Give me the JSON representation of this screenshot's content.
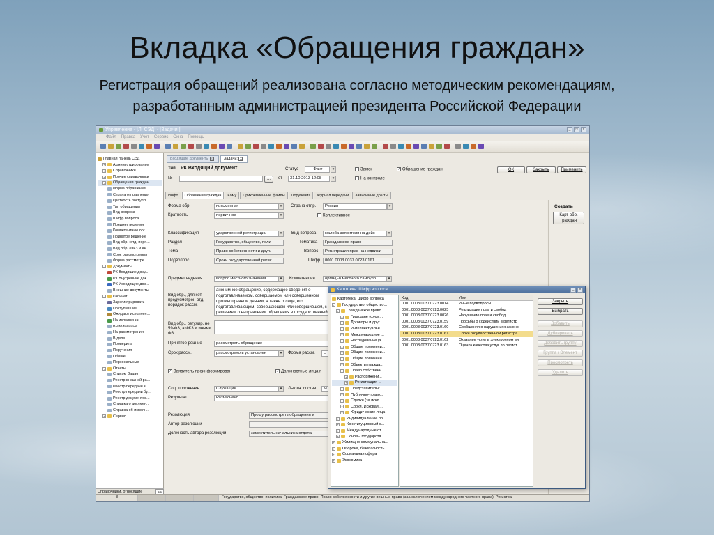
{
  "slide": {
    "title": "Вкладка «Обращения граждан»",
    "subtitle_line1": "Регистрация обращений реализована согласно методическим рекомендациям,",
    "subtitle_line2": "разработанным администрацией президента Российской Федерации"
  },
  "window": {
    "title": "Управление - [Л_СЭД] - [Задачи:]",
    "menu": [
      "Файл",
      "Правка",
      "Учет",
      "Сервис",
      "Окна",
      "Помощь"
    ]
  },
  "left_panel": {
    "items": [
      {
        "label": "Главная панель СЭД",
        "level": 0,
        "icon": "home-icon",
        "exp": ""
      },
      {
        "label": "Администрирование",
        "level": 1,
        "icon": "folder-icon",
        "exp": "+"
      },
      {
        "label": "Справочники",
        "level": 1,
        "icon": "folder-icon",
        "exp": "+"
      },
      {
        "label": "Прочие справочники",
        "level": 1,
        "icon": "folder-icon",
        "exp": "+"
      },
      {
        "label": "Обращения граждан",
        "level": 1,
        "icon": "folder-icon",
        "exp": "-"
      },
      {
        "label": "Форма обращения",
        "level": 2,
        "icon": "doc-icon",
        "exp": ""
      },
      {
        "label": "Страна отправления",
        "level": 2,
        "icon": "doc-icon",
        "exp": ""
      },
      {
        "label": "Кратность поступл...",
        "level": 2,
        "icon": "doc-icon",
        "exp": ""
      },
      {
        "label": "Тип обращения",
        "level": 2,
        "icon": "doc-icon",
        "exp": ""
      },
      {
        "label": "Вид вопроса",
        "level": 2,
        "icon": "doc-icon",
        "exp": ""
      },
      {
        "label": "Шифр вопроса",
        "level": 2,
        "icon": "doc-icon",
        "exp": ""
      },
      {
        "label": "Предмет ведения",
        "level": 2,
        "icon": "doc-icon",
        "exp": ""
      },
      {
        "label": "Компетентные орг...",
        "level": 2,
        "icon": "doc-icon",
        "exp": ""
      },
      {
        "label": "Принятое решение",
        "level": 2,
        "icon": "doc-icon",
        "exp": ""
      },
      {
        "label": "Вид обр. (отд. поря...",
        "level": 2,
        "icon": "doc-icon",
        "exp": ""
      },
      {
        "label": "Вид обр. (ФКЗ и ин...",
        "level": 2,
        "icon": "doc-icon",
        "exp": ""
      },
      {
        "label": "Срок рассмотрения",
        "level": 2,
        "icon": "doc-icon",
        "exp": ""
      },
      {
        "label": "Форма рассмотре...",
        "level": 2,
        "icon": "doc-icon",
        "exp": ""
      },
      {
        "label": "Документы",
        "level": 1,
        "icon": "folder-icon",
        "exp": "-"
      },
      {
        "label": "РК Входящие доку...",
        "level": 2,
        "icon": "doc-red-icon",
        "exp": ""
      },
      {
        "label": "РК Внутренние док...",
        "level": 2,
        "icon": "doc-green-icon",
        "exp": ""
      },
      {
        "label": "РК Исходящие док...",
        "level": 2,
        "icon": "doc-blue-icon",
        "exp": ""
      },
      {
        "label": "Внешние документы",
        "level": 2,
        "icon": "doc-icon",
        "exp": ""
      },
      {
        "label": "Кабинет",
        "level": 1,
        "icon": "folder-icon",
        "exp": "-"
      },
      {
        "label": "Зарегистрировать",
        "level": 2,
        "icon": "pen-icon",
        "exp": ""
      },
      {
        "label": "Поступившие",
        "level": 2,
        "icon": "inbox-icon",
        "exp": ""
      },
      {
        "label": "Ожидают исполнен...",
        "level": 2,
        "icon": "clock-icon",
        "exp": ""
      },
      {
        "label": "На исполнении",
        "level": 2,
        "icon": "check-icon",
        "exp": ""
      },
      {
        "label": "Выполненные",
        "level": 2,
        "icon": "doc-icon",
        "exp": ""
      },
      {
        "label": "На рассмотрении",
        "level": 2,
        "icon": "doc-icon",
        "exp": ""
      },
      {
        "label": "В деле",
        "level": 2,
        "icon": "doc-icon",
        "exp": ""
      },
      {
        "label": "Проверить",
        "level": 2,
        "icon": "doc-icon",
        "exp": ""
      },
      {
        "label": "Поручения",
        "level": 2,
        "icon": "doc-icon",
        "exp": ""
      },
      {
        "label": "Общие",
        "level": 2,
        "icon": "doc-icon",
        "exp": ""
      },
      {
        "label": "Персональные",
        "level": 2,
        "icon": "doc-icon",
        "exp": ""
      },
      {
        "label": "Отчеты",
        "level": 1,
        "icon": "folder-icon",
        "exp": "-"
      },
      {
        "label": "Список. Задач",
        "level": 2,
        "icon": "doc-icon",
        "exp": ""
      },
      {
        "label": "Реестр внешней ра...",
        "level": 2,
        "icon": "doc-icon",
        "exp": ""
      },
      {
        "label": "Реестр передачи з...",
        "level": 2,
        "icon": "doc-icon",
        "exp": ""
      },
      {
        "label": "Реестр передачи бу...",
        "level": 2,
        "icon": "doc-icon",
        "exp": ""
      },
      {
        "label": "Реестр документов...",
        "level": 2,
        "icon": "doc-icon",
        "exp": ""
      },
      {
        "label": "Справка о докумен...",
        "level": 2,
        "icon": "doc-icon",
        "exp": ""
      },
      {
        "label": "Справка об исполн...",
        "level": 2,
        "icon": "doc-icon",
        "exp": ""
      },
      {
        "label": "Сервис",
        "level": 1,
        "icon": "folder-icon",
        "exp": "+"
      }
    ],
    "bottom_label": "Справочники, относящие",
    "bottom_btn": ">>"
  },
  "doc_tabs": [
    "Входящие документы",
    "Задачи:"
  ],
  "header": {
    "type_label": "Тип",
    "type_value": "РК Входящий документ",
    "num_label": "№",
    "num_btn": "...",
    "from_label": "от",
    "date_value": "31.10.2013 12:08",
    "status_label": "Статус",
    "status_value": "Факт",
    "zamok": "Замок",
    "on_control": "На контроле",
    "obr_gr": "Обращение граждан",
    "ok": "ОК",
    "close": "Закрыть",
    "apply": "Применить"
  },
  "page_tabs": [
    "Инфо",
    "Обращения граждан",
    "Кому",
    "Прикрепленные файлы",
    "Поручения",
    "Журнал передачи",
    "Зависимые док-ты"
  ],
  "form": {
    "forma_label": "Форма обр.",
    "forma_value": "письменная",
    "kratn_label": "Кратность",
    "kratn_value": "первичное",
    "country_label": "Страна отпр.",
    "country_value": "Россия",
    "collective": "Коллективное",
    "klass_label": "Классификация",
    "klass_value": "ударственной регистрации",
    "razdel_label": "Раздел",
    "razdel_value": "Государство, общество, поли",
    "tema_label": "Тема",
    "tema_value": "Право собственности и други",
    "podv_label": "Подвопрос",
    "podv_value": "Сроки государственной регис",
    "vidv_label": "Вид вопроса",
    "vidv_value": "жалоба заявителя на дейс",
    "tematika_label": "Тематика",
    "tematika_value": "Гражданское право",
    "vopros_label": "Вопрос",
    "vopros_value": "Регистрация прав на недвижи",
    "shifr_label": "Шифр",
    "shifr_value": "0001.0003.0037.0723.0161",
    "predmet_label": "Предмет ведения",
    "predmet_value": "вопрос местного значения",
    "komp_label": "Компетенция",
    "komp_value": "орган(ы) местного самоупр",
    "vidobr_label": "Вид обр., для кот. предусмотрен отд. порядок рассм.",
    "vidobr_text": "анонимное обращение, содержащее сведения о подготавливаемом, совершаемом или совершенном противоправном деянии, а также о лице, его подготавливающем, совершающем или совершившем, с решением о направлении обращения в государственный орган в соответствии с его компетенцией",
    "vidobr2_label": "Вид обр., регулир. не 59-ФЗ, а ФКЗ и иными ФЗ",
    "resh_label": "Принятое реш-ие",
    "resh_value": "рассмотреть обращение",
    "srok_label": "Срок рассм.",
    "srok_value": "рассмотрено в установлен",
    "formar_label": "Форма рассм.",
    "formar_value": "с",
    "zayav": "Заявитель проинформирован",
    "dolzh": "Должностные лица п",
    "soc_label": "Соц. положение",
    "soc_value": "Служащий",
    "lgot_label": "Льготн. состав",
    "lgot_value": "М",
    "result_label": "Результат",
    "result_value": "Разъяснено",
    "rez_label": "Резолюция",
    "rez_value": "Прошу рассмотреть обращения и",
    "avtor_label": "Автор резолюции",
    "dolzhav_label": "Должность автора резолюции",
    "dolzhav_value": "заместитель начальника отдела"
  },
  "right_panel": {
    "title": "Создать",
    "btn": "Карт обр. граждан"
  },
  "status": {
    "num": "8",
    "text": "Государство, общество, политика, Гражданское право, Право собственности и другие вещные права (за исключением международного частного права), Регистра"
  },
  "dialog": {
    "title": "Картотека: Шифр вопроса",
    "tree": [
      {
        "label": "Картотека: Шифр вопроса",
        "level": 0,
        "exp": ""
      },
      {
        "label": "Государство, общество...",
        "level": 0,
        "exp": "-"
      },
      {
        "label": "Гражданское право",
        "level": 1,
        "exp": "-"
      },
      {
        "label": "Граждане (физи...",
        "level": 2,
        "exp": "+"
      },
      {
        "label": "Договоры и друг...",
        "level": 2,
        "exp": "+"
      },
      {
        "label": "Интеллектуальн...",
        "level": 2,
        "exp": "+"
      },
      {
        "label": "Международное ...",
        "level": 2,
        "exp": "+"
      },
      {
        "label": "Наследование (з...",
        "level": 2,
        "exp": "+"
      },
      {
        "label": "Общие положени...",
        "level": 2,
        "exp": "+"
      },
      {
        "label": "Общие положени...",
        "level": 2,
        "exp": "+"
      },
      {
        "label": "Общие положени...",
        "level": 2,
        "exp": "+"
      },
      {
        "label": "Объекты гражда...",
        "level": 2,
        "exp": "+"
      },
      {
        "label": "Право собственн...",
        "level": 2,
        "exp": "-"
      },
      {
        "label": "Распоряжени...",
        "level": 3,
        "exp": "+"
      },
      {
        "label": "Регистрация ...",
        "level": 3,
        "exp": "+"
      },
      {
        "label": "Представительс...",
        "level": 2,
        "exp": "+"
      },
      {
        "label": "Публично-право...",
        "level": 2,
        "exp": "+"
      },
      {
        "label": "Сделки (за искл...",
        "level": 2,
        "exp": "+"
      },
      {
        "label": "Сроки. Исковая ...",
        "level": 2,
        "exp": "+"
      },
      {
        "label": "Юридические лица",
        "level": 2,
        "exp": "+"
      },
      {
        "label": "Индивидуальные пр...",
        "level": 1,
        "exp": "+"
      },
      {
        "label": "Конституционный с...",
        "level": 1,
        "exp": "+"
      },
      {
        "label": "Международные от...",
        "level": 1,
        "exp": "+"
      },
      {
        "label": "Основы государств...",
        "level": 1,
        "exp": "+"
      },
      {
        "label": "Жилищно-коммунальна...",
        "level": 0,
        "exp": "+"
      },
      {
        "label": "Оборона, безопасность...",
        "level": 0,
        "exp": "+"
      },
      {
        "label": "Социальная сфера",
        "level": 0,
        "exp": "+"
      },
      {
        "label": "Экономика",
        "level": 0,
        "exp": "+"
      }
    ],
    "col_code": "Код",
    "col_name": "Имя",
    "rows": [
      {
        "code": "0001.0003.0037.0723.0014",
        "name": "Иные подвопросы"
      },
      {
        "code": "0001.0003.0037.0723.0025",
        "name": "Реализация прав и свобод"
      },
      {
        "code": "0001.0003.0037.0723.0026",
        "name": "Нарушение прав и свобод"
      },
      {
        "code": "0001.0003.0037.0723.0159",
        "name": "Просьбы о содействии в регистр"
      },
      {
        "code": "0001.0003.0037.0723.0160",
        "name": "Сообщения о нарушениях законо"
      },
      {
        "code": "0001.0003.0037.0723.0161",
        "name": "Сроки государственной регистра"
      },
      {
        "code": "0001.0003.0037.0723.0162",
        "name": "Оказание услуг в электронном ви"
      },
      {
        "code": "0001.0003.0037.0723.0163",
        "name": "Оценка качества услуг по регист"
      }
    ],
    "btns": [
      "Закрыть",
      "Выбрать",
      "Добавить",
      "Дублировать",
      "Добавить группу",
      "Группа / Элемент",
      "Просмотреть",
      "Удалить"
    ]
  }
}
